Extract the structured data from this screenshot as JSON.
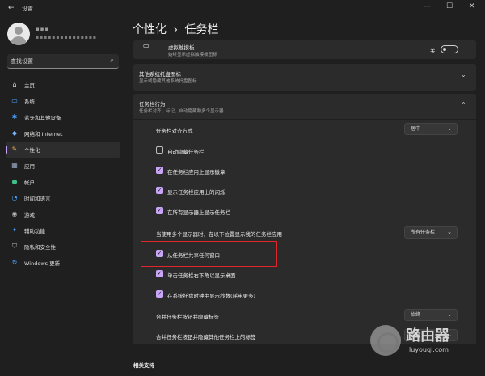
{
  "window": {
    "title": "设置",
    "back_glyph": "←",
    "minimize_glyph": "—",
    "maximize_glyph": "☐",
    "close_glyph": "✕"
  },
  "profile": {
    "name": "▪▪▪",
    "email": "▪▪▪▪▪▪▪▪▪▪▪▪▪▪▪"
  },
  "search": {
    "placeholder": "查找设置",
    "icon_glyph": "⌕"
  },
  "sidebar": {
    "items": [
      {
        "label": "主页",
        "icon": "home-icon",
        "glyph": "⌂",
        "color": "#d9d9d9"
      },
      {
        "label": "系统",
        "icon": "system-icon",
        "glyph": "▭",
        "color": "#4aa3ff"
      },
      {
        "label": "蓝牙和其他设备",
        "icon": "bluetooth-icon",
        "glyph": "✱",
        "color": "#4aa3ff"
      },
      {
        "label": "网络和 Internet",
        "icon": "network-icon",
        "glyph": "◆",
        "color": "#7ab8ff"
      },
      {
        "label": "个性化",
        "icon": "personalization-icon",
        "glyph": "✎",
        "color": "#f0a860"
      },
      {
        "label": "应用",
        "icon": "apps-icon",
        "glyph": "▦",
        "color": "#9ab0c8"
      },
      {
        "label": "帐户",
        "icon": "accounts-icon",
        "glyph": "●",
        "color": "#3cc28a"
      },
      {
        "label": "时间和语言",
        "icon": "time-language-icon",
        "glyph": "◔",
        "color": "#4aa3ff"
      },
      {
        "label": "游戏",
        "icon": "gaming-icon",
        "glyph": "◉",
        "color": "#b8b8b8"
      },
      {
        "label": "辅助功能",
        "icon": "accessibility-icon",
        "glyph": "✦",
        "color": "#4aa3ff"
      },
      {
        "label": "隐私和安全性",
        "icon": "privacy-icon",
        "glyph": "⛉",
        "color": "#b8b8b8"
      },
      {
        "label": "Windows 更新",
        "icon": "windows-update-icon",
        "glyph": "↻",
        "color": "#4aa3ff"
      }
    ],
    "active_index": 4
  },
  "page": {
    "breadcrumb_parent": "个性化",
    "breadcrumb_sep": "›",
    "breadcrumb_current": "任务栏"
  },
  "touchpad": {
    "title": "虚拟触摸板",
    "subtitle": "始终显示虚拟触摸板图标",
    "toggle_label": "关",
    "toggle_on": false
  },
  "other_tray": {
    "title": "其他系统托盘图标",
    "subtitle": "显示或隐藏其他系统托盘图标"
  },
  "behaviors": {
    "title": "任务栏行为",
    "subtitle": "任务栏对齐、标记、自动隐藏和多个显示器",
    "alignment_label": "任务栏对齐方式",
    "alignment_value": "居中",
    "auto_hide": {
      "label": "自动隐藏任务栏",
      "checked": false
    },
    "badges": {
      "label": "在任务栏应用上显示徽章",
      "checked": true
    },
    "flashing": {
      "label": "显示任务栏应用上的闪烁",
      "checked": true
    },
    "all_displays": {
      "label": "在所有显示器上显示任务栏",
      "checked": true
    },
    "multi_display_label": "当使用多个显示器时，在以下位置显示我的任务栏应用",
    "multi_display_value": "所有任务栏",
    "share_window": {
      "label": "从任务栏共享任何窗口",
      "checked": true
    },
    "far_corner": {
      "label": "单击任务栏右下角以显示桌面",
      "checked": true
    },
    "seconds": {
      "label": "在系统托盘时钟中显示秒数(耗电更多)",
      "checked": true
    },
    "combine_label": "合并任务栏按钮并隐藏标签",
    "combine_value": "始终",
    "combine_other_label": "合并任务栏按钮并隐藏其他任务栏上的标签",
    "combine_other_value": "始终"
  },
  "related": {
    "title": "相关支持"
  },
  "watermark": {
    "text": "路由器",
    "url": "luyouqi.com"
  },
  "glyphs": {
    "chevron_down": "⌄",
    "chevron_up": "⌃",
    "check": "✓",
    "touchpad": "▭"
  }
}
